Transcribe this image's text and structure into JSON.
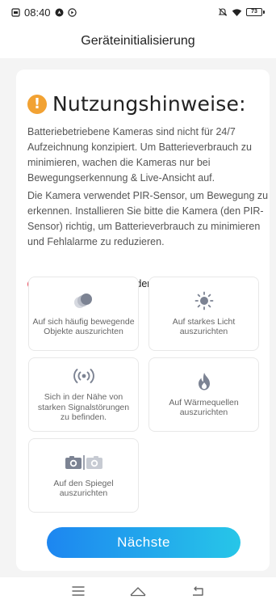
{
  "status_bar": {
    "time": "08:40",
    "battery": "73"
  },
  "header": {
    "title": "Geräteinitialisierung"
  },
  "notice": {
    "title": "Nutzungshinweise:",
    "paragraph_1": "Batteriebetriebene Kameras sind nicht für 24/7 Aufzeichnung konzipiert. Um Batterieverbrauch zu minimieren, wachen die Kameras nur bei Bewegungserkennung & Live-Ansicht auf.",
    "paragraph_2": "Die Kamera verwendet PIR-Sensor, um Bewegung zu erkennen. Installieren Sie bitte die Kamera (den PIR-Sensor) richtig, um Batterieverbrauch zu minimieren und Fehlalarme zu reduzieren."
  },
  "avoid": {
    "heading": "Kamera sollte vermeiden:",
    "items": [
      {
        "label": "Auf sich häufig bewegende Objekte auszurichten",
        "icon": "moving-objects-icon"
      },
      {
        "label": "Auf starkes Licht auszurichten",
        "icon": "sun-icon"
      },
      {
        "label": "Sich in der Nähe von starken Signalstörungen zu befinden.",
        "icon": "signal-interference-icon"
      },
      {
        "label": "Auf Wärmequellen auszurichten",
        "icon": "flame-icon"
      },
      {
        "label": "Auf den Spiegel auszurichten",
        "icon": "mirror-camera-icon"
      }
    ]
  },
  "next_button": {
    "label": "Nächste"
  },
  "colors": {
    "accent_start": "#1d86f0",
    "accent_end": "#27c6e8",
    "warning": "#f2a233",
    "danger": "#ef4d5f"
  }
}
